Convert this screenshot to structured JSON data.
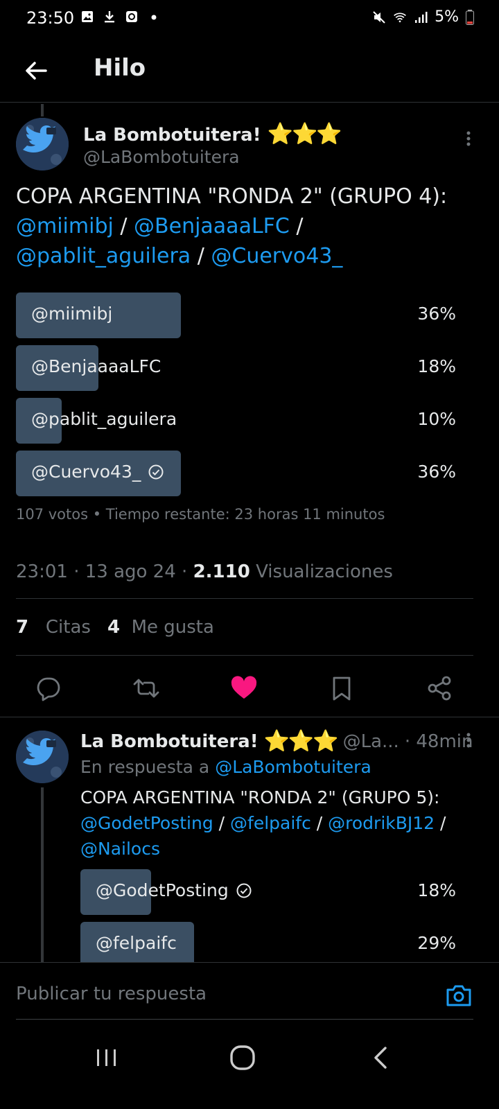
{
  "status_bar": {
    "time": "23:50",
    "battery": "5%"
  },
  "header": {
    "title": "Hilo"
  },
  "main_tweet": {
    "author_name": "La Bombotuitera!",
    "stars": "⭐⭐⭐",
    "handle": "@LaBombotuitera",
    "text_prefix": "COPA ARGENTINA \"RONDA 2\" (GRUPO 4):",
    "mentions": [
      "@miimibj",
      "@BenjaaaaLFC",
      "@pablit_aguilera",
      "@Cuervo43_"
    ],
    "separator": " / ",
    "poll": {
      "options": [
        {
          "label": "@miimibj",
          "percent": "36%",
          "fraction": 0.36,
          "selected": false
        },
        {
          "label": "@BenjaaaaLFC",
          "percent": "18%",
          "fraction": 0.18,
          "selected": false
        },
        {
          "label": "@pablit_aguilera",
          "percent": "10%",
          "fraction": 0.1,
          "selected": false
        },
        {
          "label": "@Cuervo43_",
          "percent": "36%",
          "fraction": 0.36,
          "selected": true
        }
      ],
      "meta": "107 votos • Tiempo restante: 23 horas 11 minutos"
    },
    "timestamp": "23:01 · 13 ago 24 · ",
    "views_count": "2.110",
    "views_label": "Visualizaciones",
    "quotes_count": "7",
    "quotes_label": "Citas",
    "likes_count": "4",
    "likes_label": "Me gusta"
  },
  "reply_tweet": {
    "author_name": "La Bombotuitera!",
    "stars": "⭐⭐⭐",
    "handle": "@La...",
    "time": "· 48min",
    "reply_to_label": "En respuesta a",
    "reply_to_handle": "@LaBombotuitera",
    "text_prefix": "COPA ARGENTINA \"RONDA 2\" (GRUPO 5):",
    "mentions": [
      "@GodetPosting",
      "@felpaifc",
      "@rodrikBJ12",
      "@Nailocs"
    ],
    "poll": {
      "options": [
        {
          "label": "@GodetPosting",
          "percent": "18%",
          "fraction": 0.18,
          "selected": true
        },
        {
          "label": "@felpaifc",
          "percent": "29%",
          "fraction": 0.29,
          "selected": false
        }
      ]
    }
  },
  "reply_box": {
    "placeholder": "Publicar tu respuesta"
  },
  "colors": {
    "accent": "#1d9bf0",
    "like": "#f91880",
    "poll_fill": "#3b4f63",
    "background": "#000000"
  }
}
